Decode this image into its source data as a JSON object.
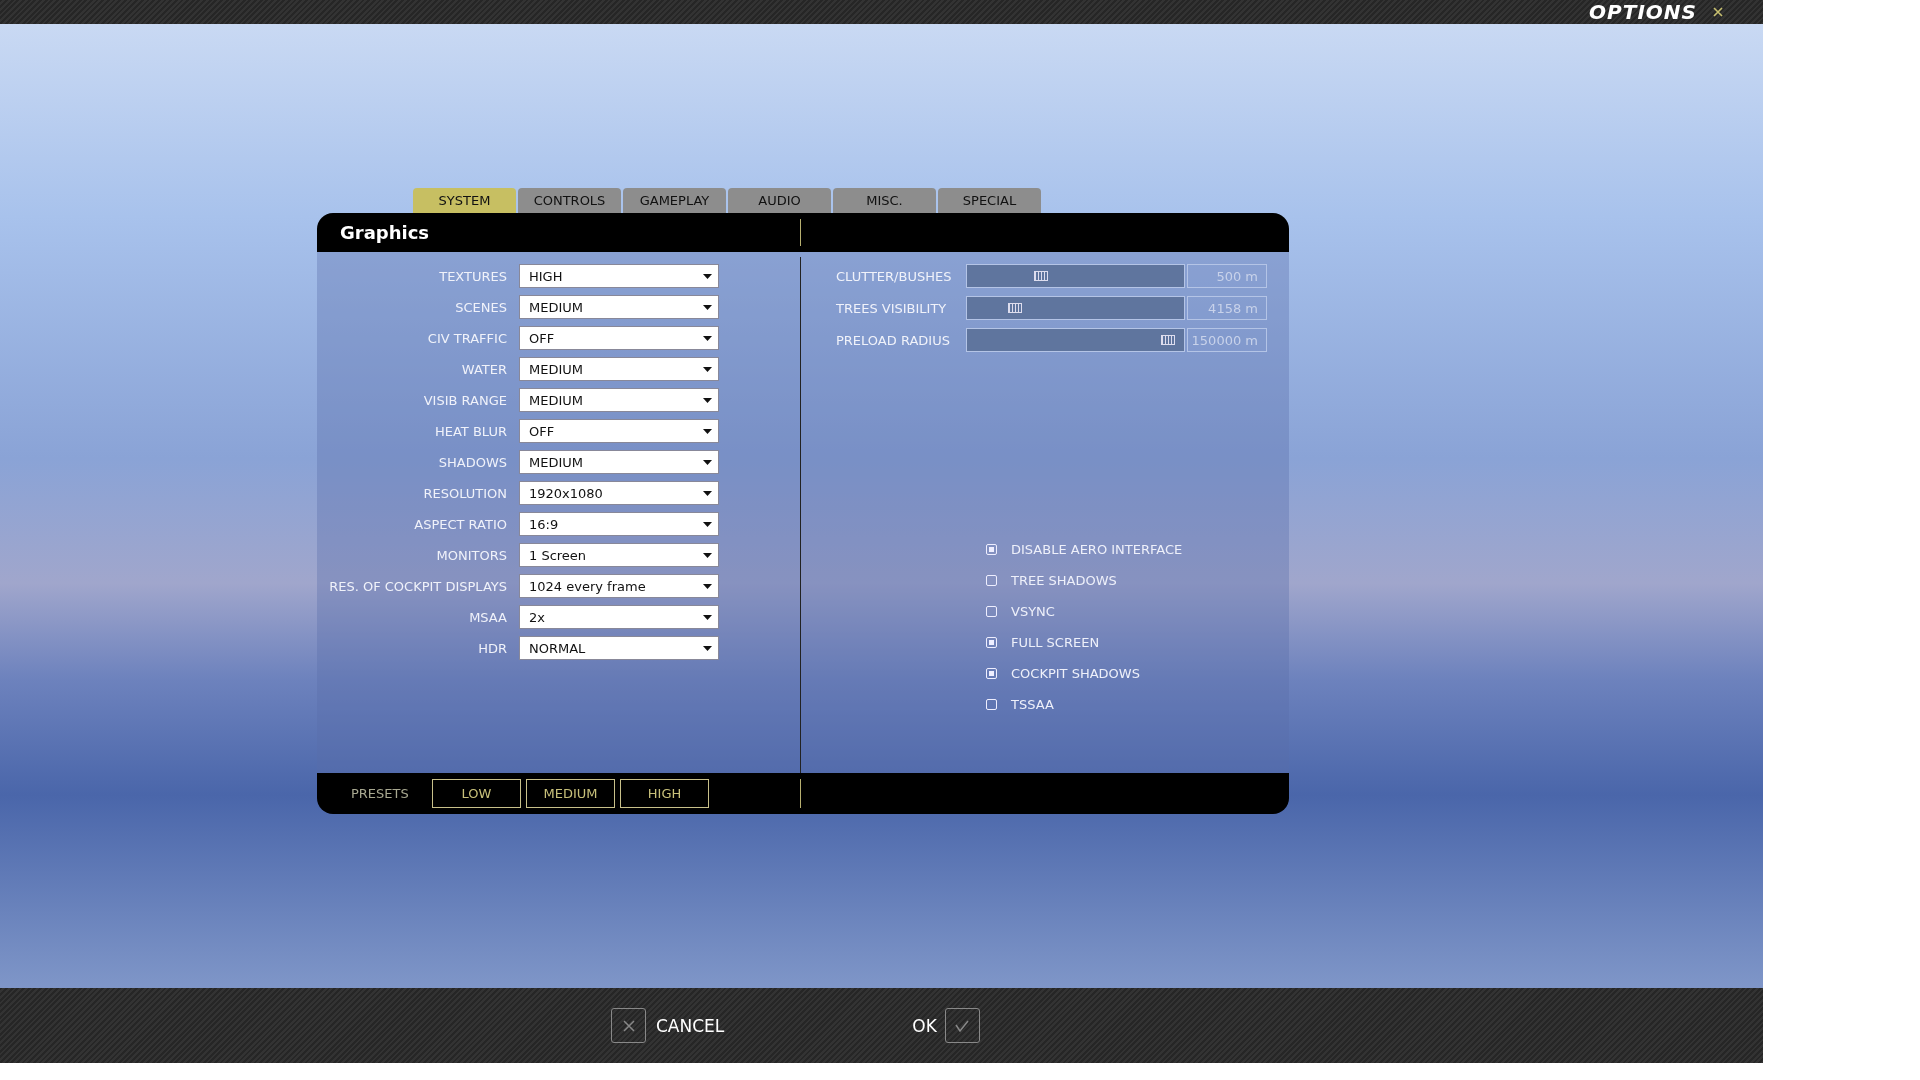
{
  "window": {
    "title": "OPTIONS"
  },
  "tabs": [
    {
      "label": "SYSTEM",
      "selected": true
    },
    {
      "label": "CONTROLS",
      "selected": false
    },
    {
      "label": "GAMEPLAY",
      "selected": false
    },
    {
      "label": "AUDIO",
      "selected": false
    },
    {
      "label": "MISC.",
      "selected": false
    },
    {
      "label": "SPECIAL",
      "selected": false
    }
  ],
  "panel_title": "Graphics",
  "dropdowns": [
    {
      "label": "TEXTURES",
      "value": "HIGH"
    },
    {
      "label": "SCENES",
      "value": "MEDIUM"
    },
    {
      "label": "CIV TRAFFIC",
      "value": "OFF"
    },
    {
      "label": "WATER",
      "value": "MEDIUM"
    },
    {
      "label": "VISIB RANGE",
      "value": "MEDIUM"
    },
    {
      "label": "HEAT BLUR",
      "value": "OFF"
    },
    {
      "label": "SHADOWS",
      "value": "MEDIUM"
    },
    {
      "label": "RESOLUTION",
      "value": "1920x1080"
    },
    {
      "label": "ASPECT RATIO",
      "value": "16:9"
    },
    {
      "label": "MONITORS",
      "value": "1 Screen"
    },
    {
      "label": "RES. OF COCKPIT DISPLAYS",
      "value": "1024 every frame"
    },
    {
      "label": "MSAA",
      "value": "2x"
    },
    {
      "label": "HDR",
      "value": "NORMAL"
    }
  ],
  "sliders": [
    {
      "label": "CLUTTER/BUSHES",
      "level": 0.33,
      "reading": "500 m"
    },
    {
      "label": "TREES VISIBILITY",
      "level": 0.2,
      "reading": "4158 m"
    },
    {
      "label": "PRELOAD RADIUS",
      "level": 0.96,
      "reading": "150000 m"
    }
  ],
  "checkboxes": [
    {
      "label": "DISABLE AERO INTERFACE",
      "checked": true
    },
    {
      "label": "TREE SHADOWS",
      "checked": false
    },
    {
      "label": "VSYNC",
      "checked": false
    },
    {
      "label": "FULL SCREEN",
      "checked": true
    },
    {
      "label": "COCKPIT SHADOWS",
      "checked": true
    },
    {
      "label": "TSSAA",
      "checked": false
    }
  ],
  "presets": {
    "label": "PRESETS",
    "buttons": [
      "LOW",
      "MEDIUM",
      "HIGH"
    ]
  },
  "actions": {
    "cancel": "CANCEL",
    "ok": "OK"
  }
}
